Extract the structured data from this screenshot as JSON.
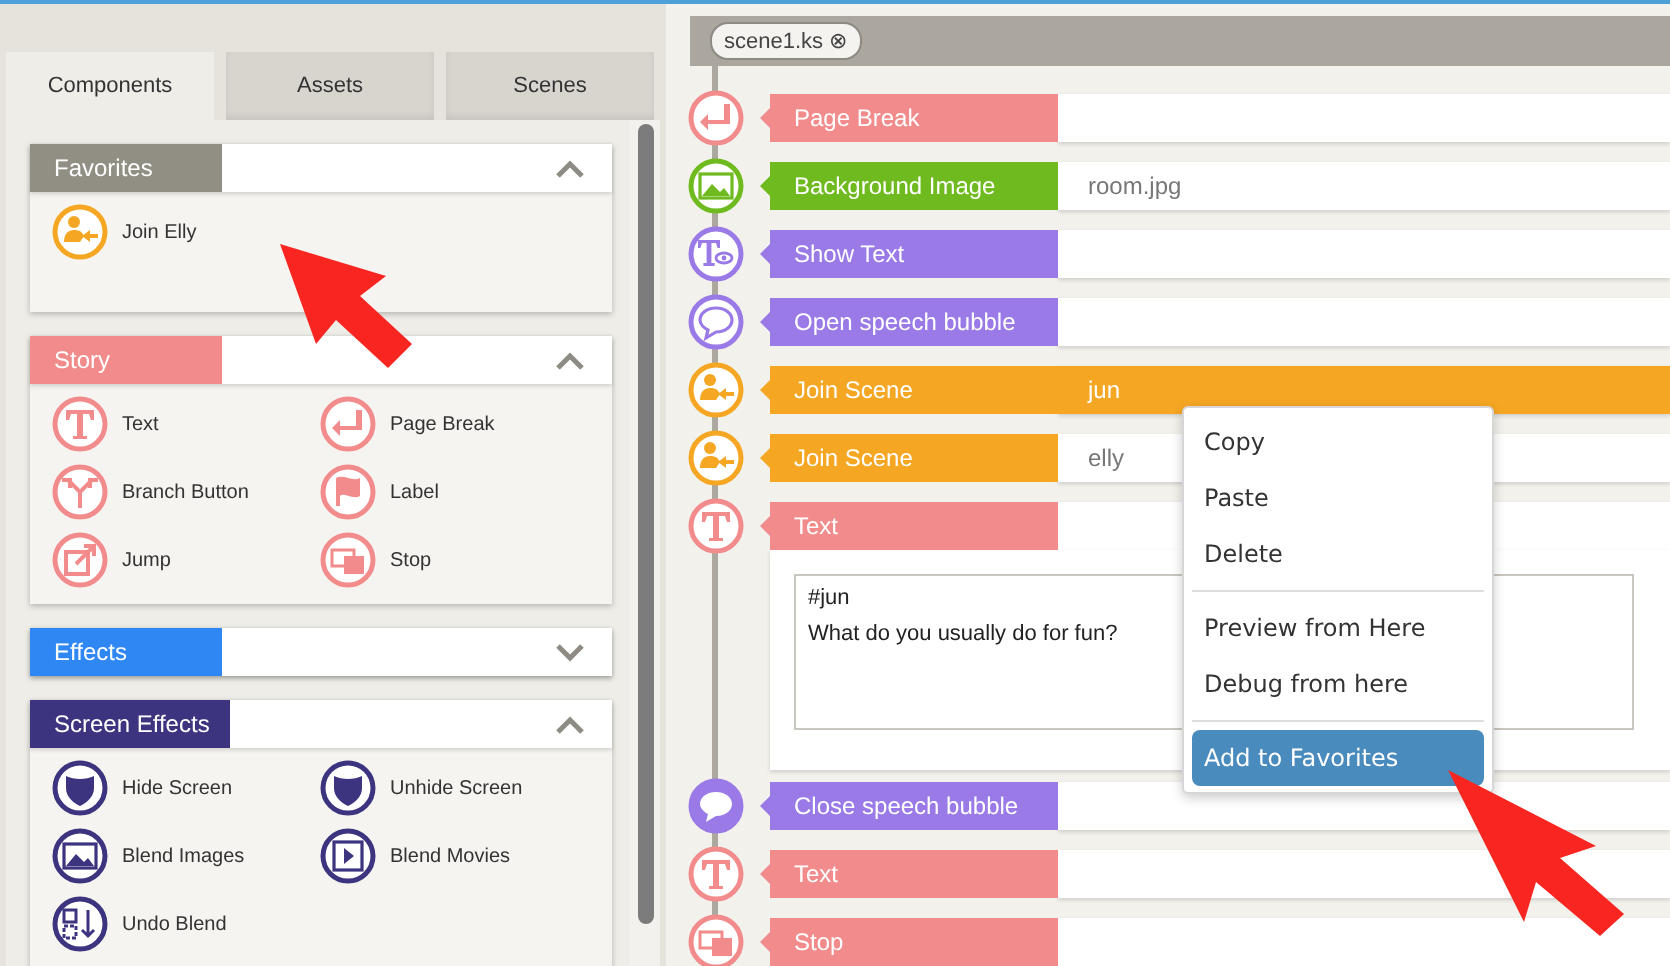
{
  "sidebar": {
    "tabs": [
      {
        "label": "Components",
        "selected": true
      },
      {
        "label": "Assets",
        "selected": false
      },
      {
        "label": "Scenes",
        "selected": false
      }
    ],
    "sections": [
      {
        "title": "Favorites",
        "color": "#918e84",
        "expanded": true,
        "items": [
          {
            "label": "Join Elly",
            "kind": "join",
            "color": "#f5a623"
          }
        ]
      },
      {
        "title": "Story",
        "color": "#f28b8b",
        "expanded": true,
        "items": [
          {
            "label": "Text",
            "kind": "text",
            "color": "#f28b8b"
          },
          {
            "label": "Page Break",
            "kind": "page-break",
            "color": "#f28b8b"
          },
          {
            "label": "Branch Button",
            "kind": "branch",
            "color": "#f28b8b"
          },
          {
            "label": "Label",
            "kind": "label",
            "color": "#f28b8b"
          },
          {
            "label": "Jump",
            "kind": "jump",
            "color": "#f28b8b"
          },
          {
            "label": "Stop",
            "kind": "stop",
            "color": "#f28b8b"
          }
        ]
      },
      {
        "title": "Effects",
        "color": "#2f87f3",
        "expanded": false
      },
      {
        "title": "Screen Effects",
        "color": "#3d3480",
        "expanded": true,
        "items": [
          {
            "label": "Hide Screen",
            "kind": "hide-screen",
            "color": "#3d3480"
          },
          {
            "label": "Unhide Screen",
            "kind": "unhide-screen",
            "color": "#3d3480"
          },
          {
            "label": "Blend Images",
            "kind": "blend-images",
            "color": "#3d3480"
          },
          {
            "label": "Blend Movies",
            "kind": "blend-movies",
            "color": "#3d3480"
          },
          {
            "label": "Undo Blend",
            "kind": "undo-blend",
            "color": "#3d3480"
          }
        ]
      }
    ]
  },
  "editor": {
    "file_tab": {
      "label": "scene1.ks",
      "close": "⊗"
    },
    "rows": [
      {
        "label": "Page Break",
        "kind": "page-break",
        "color": "#f28c8c",
        "selected": false
      },
      {
        "label": "Background Image",
        "kind": "background-image",
        "color": "#6fbb1f",
        "value": "room.jpg",
        "selected": false
      },
      {
        "label": "Show Text",
        "kind": "show-text",
        "color": "#9a7ae6",
        "selected": false
      },
      {
        "label": "Open speech bubble",
        "kind": "open-bubble",
        "color": "#9a7ae6",
        "selected": false
      },
      {
        "label": "Join Scene",
        "kind": "join",
        "color": "#f5a623",
        "value": "jun",
        "selected": true
      },
      {
        "label": "Join Scene",
        "kind": "join",
        "color": "#f5a623",
        "value": "elly",
        "selected": false
      },
      {
        "label": "Text",
        "kind": "text",
        "color": "#f28c8c",
        "body": "#jun\nWhat do you usually do for fun?",
        "selected": false
      },
      {
        "label": "Close speech bubble",
        "kind": "close-bubble",
        "color": "#9a7ae6",
        "selected": false
      },
      {
        "label": "Text",
        "kind": "text",
        "color": "#f28c8c",
        "selected": false
      },
      {
        "label": "Stop",
        "kind": "stop",
        "color": "#f28c8c",
        "selected": false
      }
    ]
  },
  "context_menu": {
    "groups": [
      [
        {
          "label": "Copy",
          "selected": false
        },
        {
          "label": "Paste",
          "selected": false
        },
        {
          "label": "Delete",
          "selected": false
        }
      ],
      [
        {
          "label": "Preview from Here",
          "selected": false
        },
        {
          "label": "Debug from here",
          "selected": false
        }
      ],
      [
        {
          "label": "Add to Favorites",
          "selected": true
        }
      ]
    ]
  }
}
